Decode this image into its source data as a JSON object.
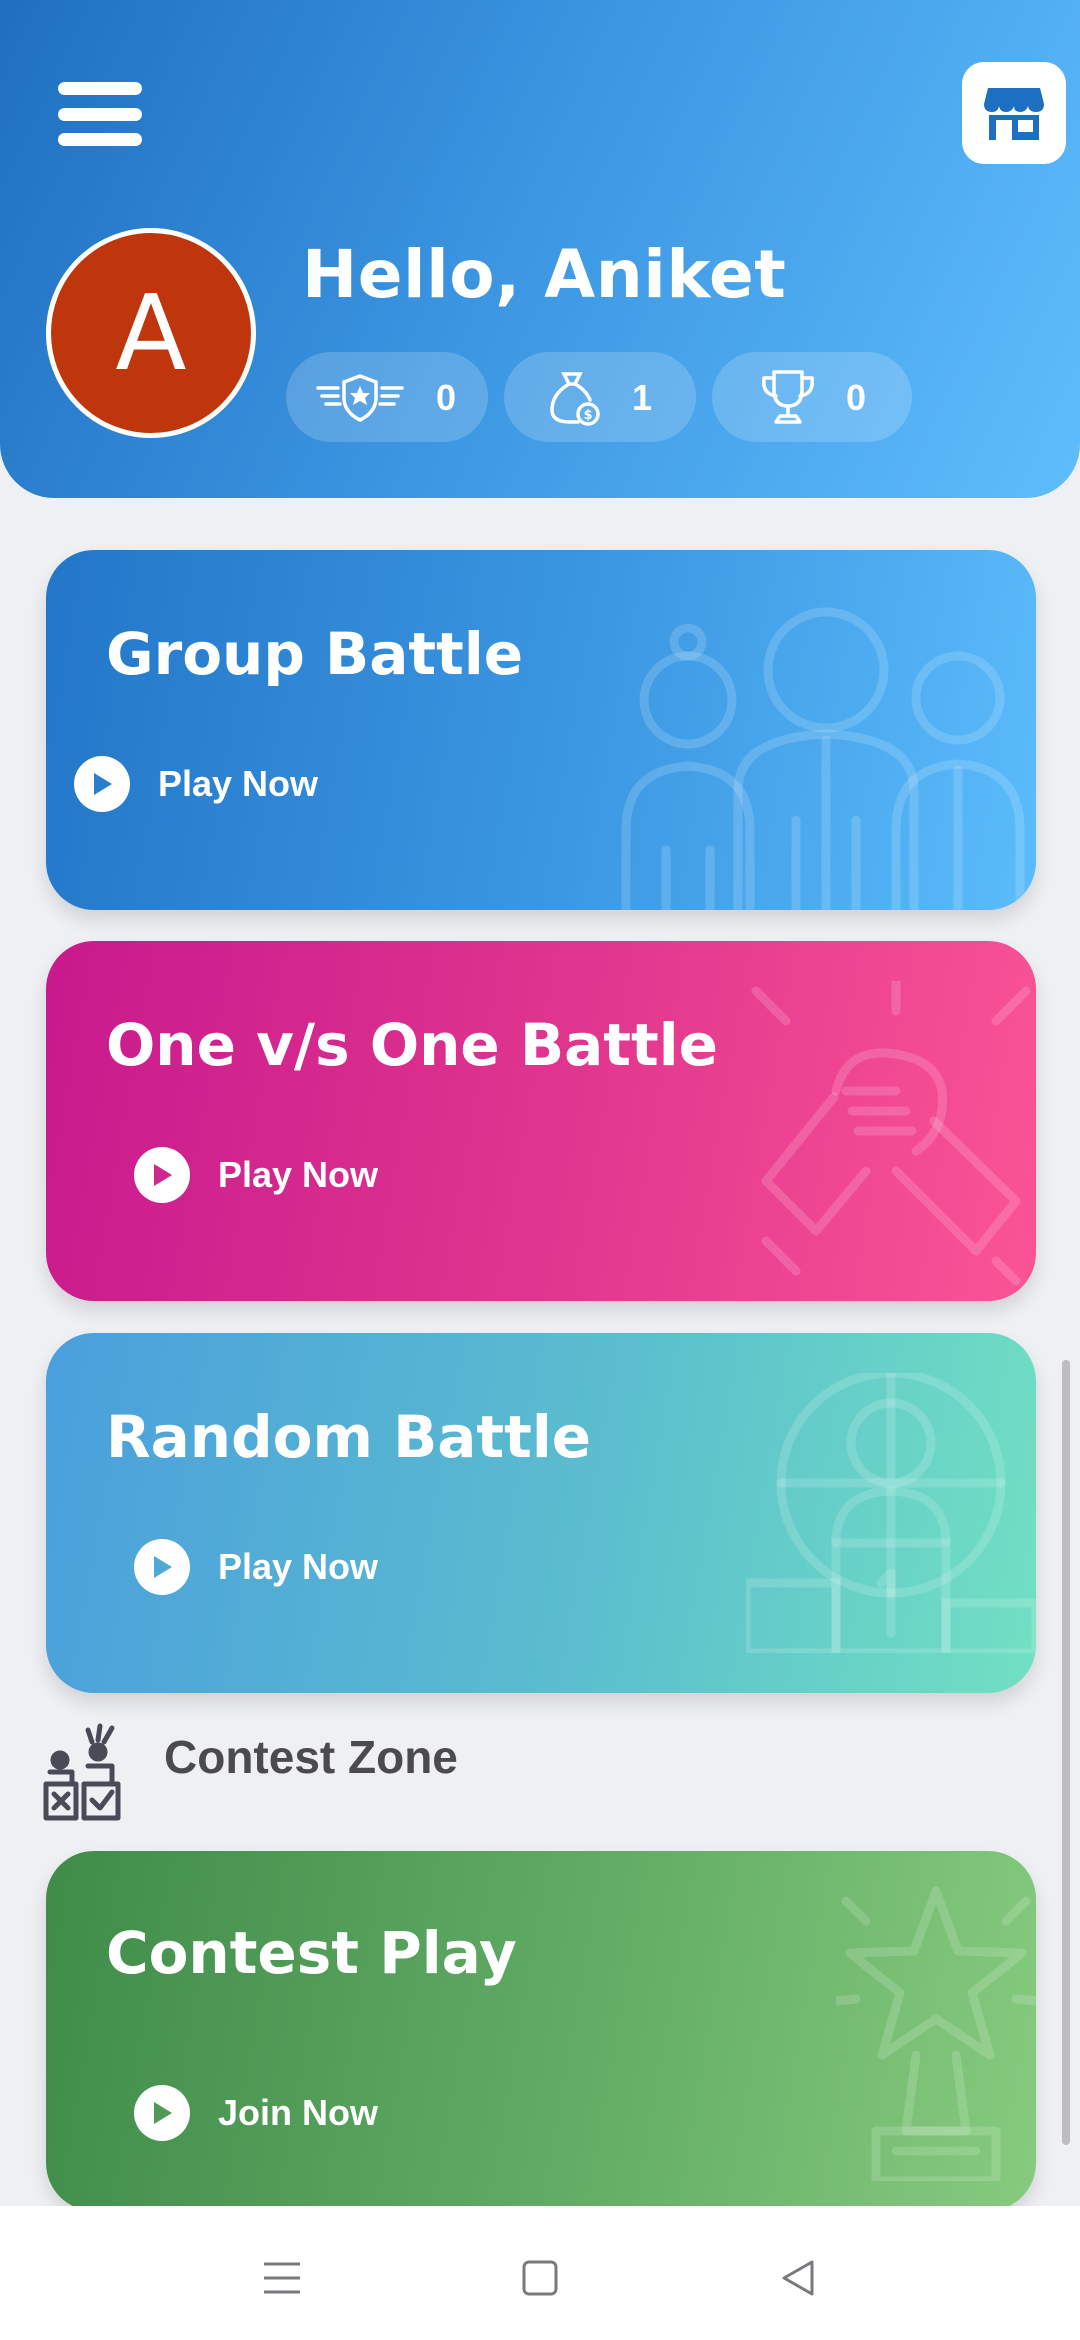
{
  "header": {
    "greeting": "Hello, Aniket",
    "avatar_letter": "A",
    "avatar_color": "#bf360c",
    "menu_icon": "hamburger-menu-icon",
    "shop_icon": "store-icon",
    "stats": [
      {
        "icon": "winged-star-badge-icon",
        "value": "0"
      },
      {
        "icon": "coin-bag-icon",
        "value": "1"
      },
      {
        "icon": "trophy-icon",
        "value": "0"
      }
    ]
  },
  "cards": [
    {
      "title": "Group Battle",
      "action": "Play Now",
      "illustration": "group-people-icon"
    },
    {
      "title": "One v/s One Battle",
      "action": "Play Now",
      "illustration": "handshake-arm-wrestle-icon"
    },
    {
      "title": "Random Battle",
      "action": "Play Now",
      "illustration": "globe-podium-winner-icon"
    }
  ],
  "contest_zone": {
    "title": "Contest Zone",
    "icon": "contest-voting-icon",
    "card": {
      "title": "Contest Play",
      "action": "Join Now",
      "illustration": "star-trophy-icon"
    }
  },
  "navbar": {
    "items": [
      "recent-apps-icon",
      "home-square-icon",
      "back-triangle-icon"
    ]
  },
  "colors": {
    "header_start": "#1f6fc0",
    "header_end": "#5fbdfc",
    "group_battle": "#3c98e2",
    "one_vs_one": "#e2378f",
    "random_battle": "#5bbdce",
    "contest_play": "#62ac65",
    "background": "#eff0f4"
  }
}
